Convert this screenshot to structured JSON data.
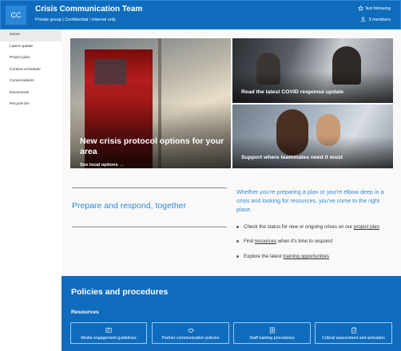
{
  "site": {
    "logo_initials": "CC",
    "title": "Crisis Communication Team",
    "subtitle": "Private group | Confidential \\ Internal only",
    "follow_label": "Not following",
    "members_label": "3 members"
  },
  "nav": {
    "items": [
      {
        "label": "Home"
      },
      {
        "label": "Latest update"
      },
      {
        "label": "Project plan"
      },
      {
        "label": "Content scheduler"
      },
      {
        "label": "Conversations"
      },
      {
        "label": "Documents"
      },
      {
        "label": "Recycle bin"
      }
    ]
  },
  "hero": {
    "main_title": "New crisis protocol options for your area",
    "main_link": "See local options →",
    "tile_top_right": "Read the latest COVID response update",
    "tile_bottom_right": "Support where teammates need it most"
  },
  "prepare": {
    "title": "Prepare and respond, together",
    "quote": "Whether you're preparing a plan or you're elbow deep in a crisis and looking for resources, you've come to the right place.",
    "bullets": [
      {
        "pre": "Check the status for new or ongoing crises on our ",
        "link": "project plan",
        "post": ""
      },
      {
        "pre": "Find ",
        "link": "resources",
        "post": " when it's time to respond"
      },
      {
        "pre": "Explore the latest ",
        "link": "training opportunities",
        "post": ""
      }
    ]
  },
  "policies": {
    "title": "Policies and procedures",
    "resources_label": "Resources",
    "buttons": [
      {
        "label": "Media engagement guidelines",
        "icon": "media-icon"
      },
      {
        "label": "Partner communication policies",
        "icon": "handshake-icon"
      },
      {
        "label": "Staff training procedures",
        "icon": "training-icon"
      },
      {
        "label": "Critical assessment and activation",
        "icon": "clipboard-icon"
      }
    ]
  },
  "colors": {
    "brand": "#0f6cbd",
    "accent_text": "#2b88d8",
    "nav_active": "#edebe9"
  }
}
